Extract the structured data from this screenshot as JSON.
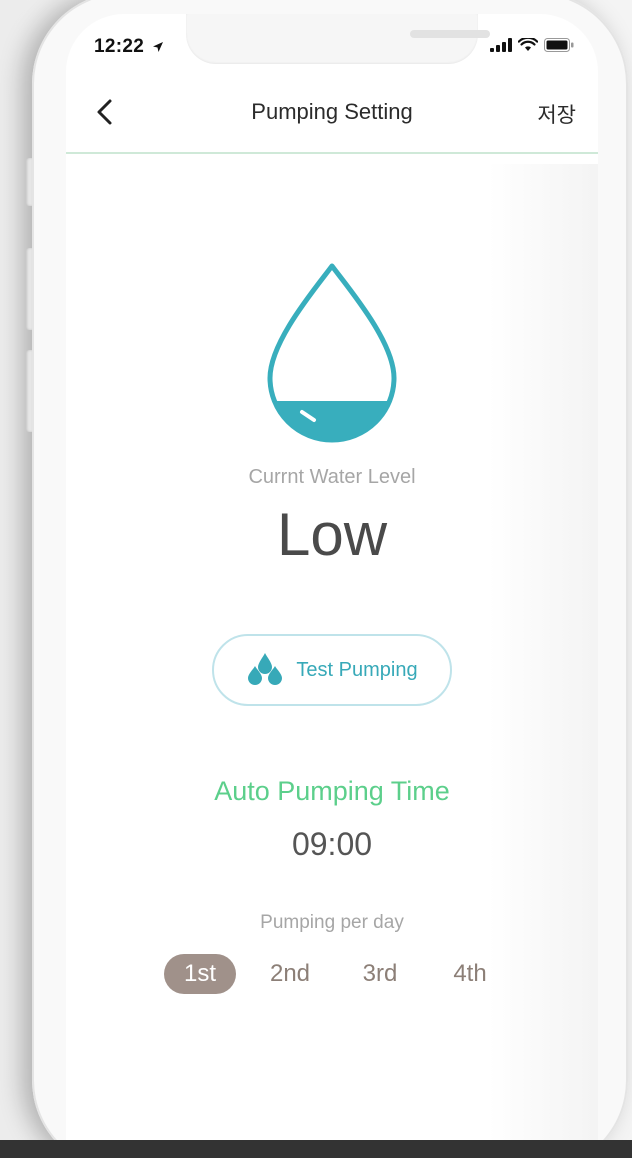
{
  "status_bar": {
    "time": "12:22",
    "location_icon": "location-arrow-icon",
    "signal_icon": "cellular-signal-icon",
    "wifi_icon": "wifi-icon",
    "battery_icon": "battery-icon"
  },
  "nav": {
    "back_icon": "chevron-left-icon",
    "title": "Pumping Setting",
    "save_label": "저장"
  },
  "water": {
    "icon": "water-drop-icon",
    "caption": "Currnt Water Level",
    "level": "Low"
  },
  "test_pumping": {
    "icon": "droplets-icon",
    "label": "Test Pumping"
  },
  "auto_pumping": {
    "title": "Auto Pumping Time",
    "time": "09:00"
  },
  "pumping_per_day": {
    "label": "Pumping per day",
    "options": [
      "1st",
      "2nd",
      "3rd",
      "4th"
    ],
    "selected": "1st"
  },
  "colors": {
    "accent_teal": "#37a9b8",
    "accent_green": "#5ccf8b",
    "selected_chip": "#a0918a"
  }
}
